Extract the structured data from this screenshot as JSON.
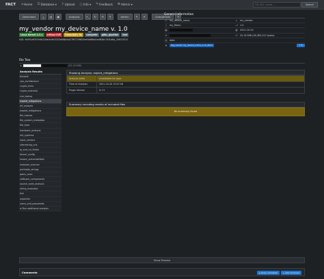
{
  "nav": {
    "brand": "FACT",
    "items": [
      {
        "icon": "⌂",
        "label": "Home"
      },
      {
        "icon": "☰",
        "label": "Database ▾"
      },
      {
        "icon": "⇪",
        "label": "Upload"
      },
      {
        "icon": "ⓘ",
        "label": "Info ▾"
      },
      {
        "icon": "✎",
        "label": "Feedback"
      },
      {
        "icon": "⚙",
        "label": "Admin ▾"
      }
    ],
    "search_placeholder": "FW UID, name, ...",
    "search_button": "Search"
  },
  "toolbar": {
    "download": "Download",
    "analysis": "Analysis",
    "admin": "Admin",
    "comparison": "Comparison"
  },
  "firmware": {
    "title": "my_vendor my_device_name v. 1.0",
    "badges": [
      {
        "label": "Linux Kernel 4.3.x",
        "color": "#2e7d32"
      },
      {
        "label": "critical CVE",
        "color": "#c62828"
      },
      {
        "label": "Potentially fix",
        "color": "#c09006"
      },
      {
        "label": "complete",
        "color": "#455a64"
      },
      {
        "label": "glibc_pipeline",
        "color": "#455a64"
      },
      {
        "label": "test",
        "color": "#455a64"
      }
    ],
    "uid": "UID: 9e5f1a93f7e5b23de4c9b7033ef08d4d2780739653ee9af6bb4ed83bc74f1b6a_25613512"
  },
  "general_info": {
    "heading": "General Information",
    "device_name": "my_device_name",
    "vendor": "my_vendor",
    "file_name": "my_fileno",
    "version": "1.0",
    "date": "2021-10-20",
    "size": "25.16 MiB (26,383,512 bytes)",
    "file_type": "data",
    "tag_select": "tag_vendor my_device_name_v1.0_2021",
    "tag_button": "+ ▾"
  },
  "file_tree": {
    "heading": "File Tree",
    "root_size": "(25.16 MiB)"
  },
  "sidebar": {
    "heading": "Analysis Results",
    "items": [
      "binwalk",
      "cpu_architecture",
      "crypto_hints",
      "crypto_material",
      "cve_lookup",
      "exploit_mitigations",
      "elf_analysis",
      "exploit_mitigations",
      "file_hashes",
      "file_system_metadata",
      "file_type",
      "hardware_analysis",
      "init_systems",
      "input_vectors",
      "interesting_uris",
      "ip_and_uri_finder",
      "kernel_config",
      "known_vulnerabilities",
      "malware_scanner",
      "printable_strings",
      "qemu_exec",
      "software_components",
      "source_code_analysis",
      "string_evaluator",
      "tlsh",
      "unpacker",
      "users_and_passwords",
      "⊕ Run additional analysis"
    ],
    "active_index": 5
  },
  "main": {
    "panel_title": "Showing Analysis: exploit_mitigations",
    "rows": [
      {
        "key": "Analysis state",
        "value": "invalidated for type"
      },
      {
        "key": "Time of Analysis",
        "value": "2021-10-20 13:07:26"
      },
      {
        "key": "Plugin Version",
        "value": "0.1.5"
      }
    ],
    "summary_title": "Summary including results of included files",
    "summary_empty": "No summary found"
  },
  "footer": {
    "show_preview": "Show Preview",
    "comments": "Comments",
    "show_comments": "▸ show comments",
    "add_comment": "+ add comment",
    "powered": "powered by FACT 3.3-dev",
    "copyright": "© Fraunhofer FKIE 2015-2021"
  }
}
